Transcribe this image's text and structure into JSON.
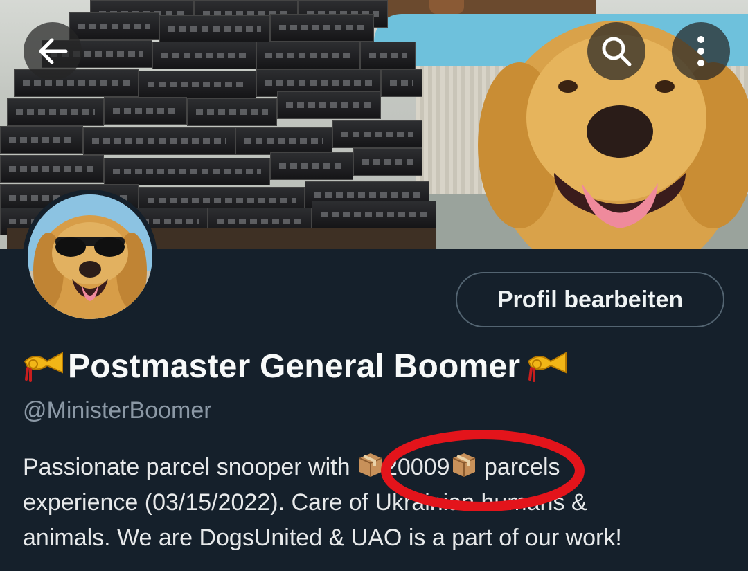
{
  "header": {
    "back_icon": "arrow-left-icon",
    "search_icon": "search-icon",
    "more_icon": "more-vertical-icon"
  },
  "profile": {
    "edit_button_label": "Profil bearbeiten",
    "display_name": "Postmaster General Boomer",
    "name_prefix_emoji": "postal-horn-icon",
    "name_suffix_emoji": "postal-horn-icon",
    "handle": "@MinisterBoomer",
    "bio": {
      "line1_a": "Passionate parcel snooper with ",
      "parcel_count": "20009",
      "line1_b": " parcels",
      "line2": "experience (03/15/2022). Care  of Ukrainian humans &",
      "line3": "animals. We are DogsUnited & UAO is a part of our work!"
    }
  },
  "colors": {
    "background": "#15202b",
    "handle": "#8b98a5",
    "button_border": "#536471",
    "annotation_red": "#e3141b"
  }
}
